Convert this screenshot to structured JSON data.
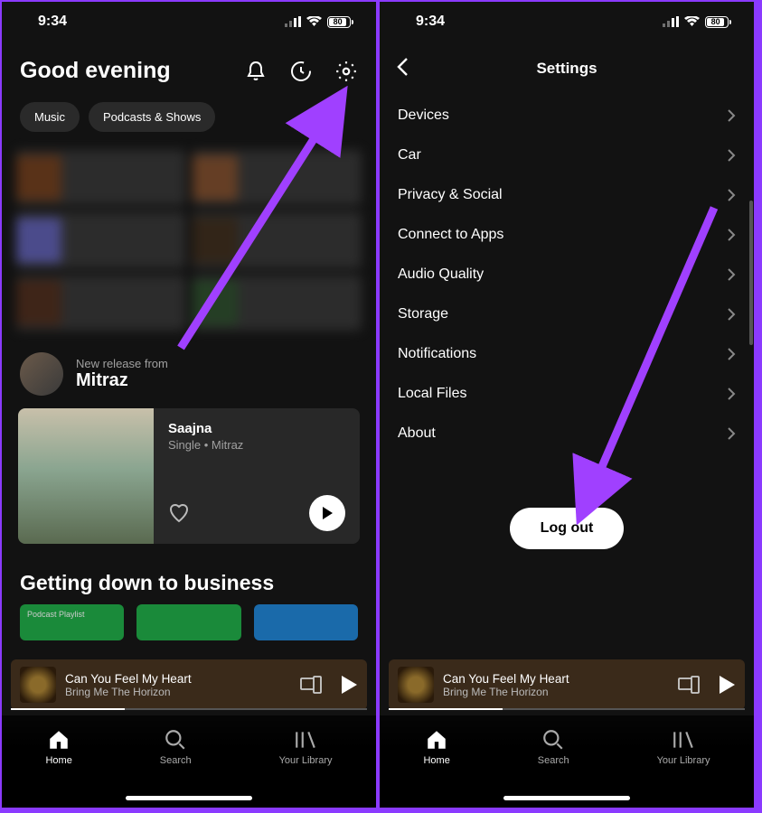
{
  "status_bar": {
    "time": "9:34",
    "battery": "80"
  },
  "home": {
    "greeting": "Good evening",
    "chips": {
      "music": "Music",
      "podcasts": "Podcasts & Shows"
    },
    "release": {
      "sub": "New release from",
      "artist": "Mitraz",
      "track_title": "Saajna",
      "track_meta": "Single • Mitraz"
    },
    "section_title": "Getting down to business",
    "carousel_label": "Podcast Playlist"
  },
  "now_playing": {
    "title": "Can You Feel My Heart",
    "artist": "Bring Me The Horizon"
  },
  "nav": {
    "home": "Home",
    "search": "Search",
    "library": "Your Library"
  },
  "settings": {
    "title": "Settings",
    "items": {
      "devices": "Devices",
      "car": "Car",
      "privacy": "Privacy & Social",
      "connect": "Connect to Apps",
      "audio": "Audio Quality",
      "storage": "Storage",
      "notifications": "Notifications",
      "localfiles": "Local Files",
      "about": "About"
    },
    "logout": "Log out"
  }
}
